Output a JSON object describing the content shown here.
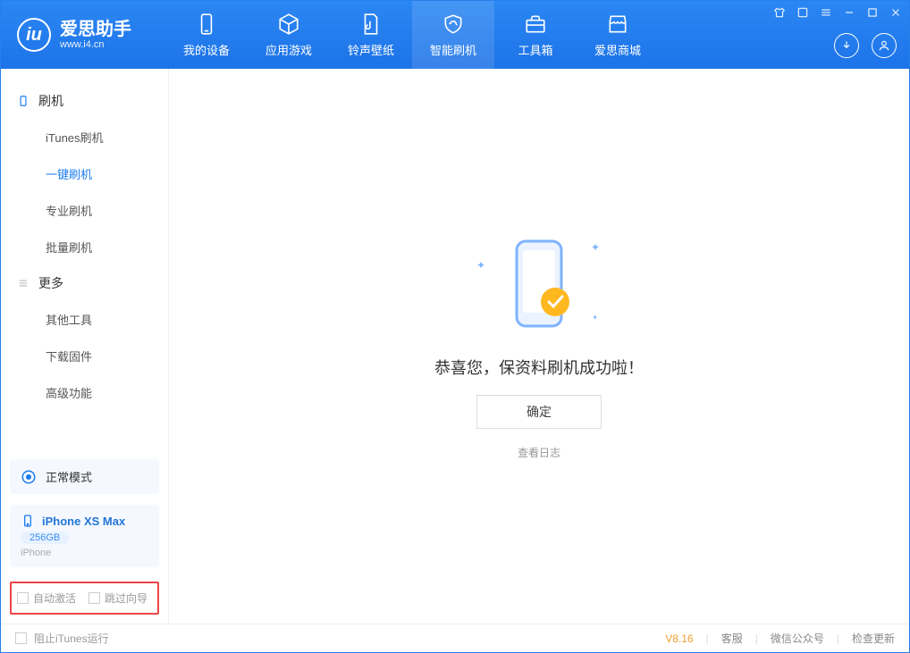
{
  "app": {
    "title": "爱思助手",
    "subtitle": "www.i4.cn"
  },
  "nav": [
    {
      "label": "我的设备"
    },
    {
      "label": "应用游戏"
    },
    {
      "label": "铃声壁纸"
    },
    {
      "label": "智能刷机"
    },
    {
      "label": "工具箱"
    },
    {
      "label": "爱思商城"
    }
  ],
  "sidebar": {
    "group1": {
      "title": "刷机",
      "items": [
        "iTunes刷机",
        "一键刷机",
        "专业刷机",
        "批量刷机"
      ]
    },
    "group2": {
      "title": "更多",
      "items": [
        "其他工具",
        "下载固件",
        "高级功能"
      ]
    }
  },
  "mode": {
    "label": "正常模式"
  },
  "device": {
    "name": "iPhone XS Max",
    "storage": "256GB",
    "type": "iPhone"
  },
  "options": {
    "autoActivate": "自动激活",
    "skipGuide": "跳过向导"
  },
  "main": {
    "success": "恭喜您，保资料刷机成功啦！",
    "confirm": "确定",
    "viewLog": "查看日志"
  },
  "footer": {
    "blockItunes": "阻止iTunes运行",
    "version": "V8.16",
    "links": [
      "客服",
      "微信公众号",
      "检查更新"
    ]
  }
}
